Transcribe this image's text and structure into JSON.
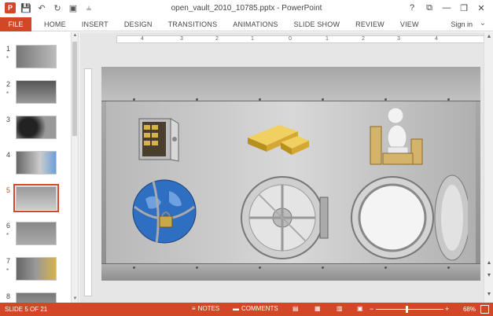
{
  "titlebar": {
    "app_icon": "P",
    "title": "open_vault_2010_10785.pptx - PowerPoint",
    "controls": [
      "?",
      "⧉",
      "—",
      "❐",
      "✕"
    ]
  },
  "ribbon": {
    "file": "FILE",
    "tabs": [
      "HOME",
      "INSERT",
      "DESIGN",
      "TRANSITIONS",
      "ANIMATIONS",
      "SLIDE SHOW",
      "REVIEW",
      "VIEW"
    ],
    "signin": "Sign in"
  },
  "thumbnails": [
    {
      "num": "1",
      "star": "*"
    },
    {
      "num": "2",
      "star": "*"
    },
    {
      "num": "3",
      "star": ""
    },
    {
      "num": "4",
      "star": ""
    },
    {
      "num": "5",
      "star": "",
      "selected": true
    },
    {
      "num": "6",
      "star": "*"
    },
    {
      "num": "7",
      "star": "*"
    },
    {
      "num": "8",
      "star": ""
    }
  ],
  "ruler": {
    "marks": [
      "4",
      "3",
      "2",
      "1",
      "0",
      "1",
      "2",
      "3",
      "4"
    ]
  },
  "status": {
    "slide": "SLIDE 5 OF 21",
    "notes": "NOTES",
    "comments": "COMMENTS",
    "zoom": "68%",
    "minus": "−",
    "plus": "+"
  },
  "colors": {
    "accent": "#d24726"
  }
}
